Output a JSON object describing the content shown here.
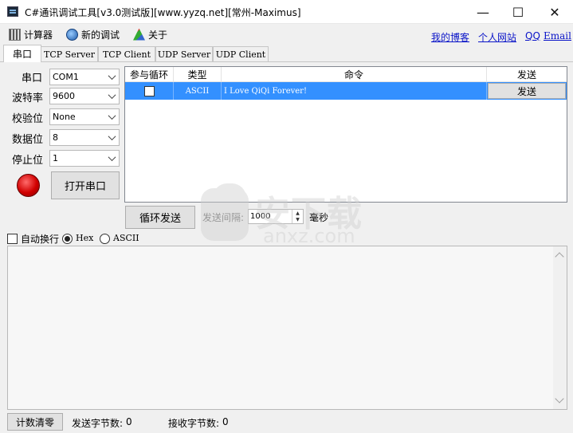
{
  "window": {
    "title": "C#通讯调试工具[v3.0测试版][www.yyzq.net][常州-Maximus]",
    "minimize_glyph": "—",
    "maximize_glyph": "☐",
    "close_glyph": "✕"
  },
  "menu": {
    "calculator": "计算器",
    "new_debug": "新的调试",
    "about": "关于"
  },
  "links": {
    "blog": "我的博客",
    "website": "个人网站",
    "qq": "QQ",
    "email": "Email"
  },
  "tabs": [
    "串口",
    "TCP Server",
    "TCP Client",
    "UDP Server",
    "UDP Client"
  ],
  "serial": {
    "port_label": "串口",
    "port_value": "COM1",
    "baud_label": "波特率",
    "baud_value": "9600",
    "parity_label": "校验位",
    "parity_value": "None",
    "databits_label": "数据位",
    "databits_value": "8",
    "stopbits_label": "停止位",
    "stopbits_value": "1",
    "open_button": "打开串口",
    "led_color": "#d10000"
  },
  "grid": {
    "headers": [
      "参与循环",
      "类型",
      "命令",
      "发送"
    ],
    "rows": [
      {
        "loop": false,
        "type": "ASCII",
        "command": "I Love QiQi Forever!",
        "send": "发送"
      }
    ],
    "selection_color": "#3390ff"
  },
  "loop": {
    "button": "循环发送",
    "interval_label": "发送间隔:",
    "interval_value": "1000",
    "unit": "毫秒"
  },
  "options": {
    "auto_wrap": "自动换行",
    "auto_wrap_checked": false,
    "hex": "Hex",
    "ascii": "ASCII",
    "mode_selected": "Hex"
  },
  "status": {
    "clear_button": "计数清零",
    "sent_label": "发送字节数:",
    "sent_value": "0",
    "recv_label": "接收字节数:",
    "recv_value": "0"
  },
  "watermark": {
    "cn": "安下载",
    "en": "anxz.com"
  }
}
